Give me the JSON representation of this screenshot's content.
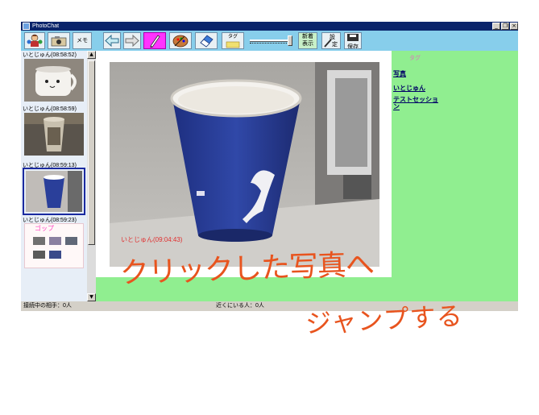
{
  "window": {
    "title": "PhotoChat"
  },
  "toolbar": {
    "memo_label": "メモ",
    "tag_label": "タグ",
    "new_label_line1": "新着",
    "new_label_line2": "表示",
    "settings_label_line1": "設",
    "settings_label_line2": "定",
    "save_label": "保存"
  },
  "thumbnails": [
    {
      "caption": "いとじゅん(08:58:52)"
    },
    {
      "caption": "いとじゅん(08:58:59)"
    },
    {
      "caption": "いとじゅん(08:59:13)"
    },
    {
      "caption": "いとじゅん(08:59:23)"
    }
  ],
  "thumb4": {
    "handwriting": "ゴップ"
  },
  "main": {
    "photo_overlay": "いとじゅん(09:04:43)"
  },
  "annotation": {
    "line1": "クリックした写真へ",
    "line2": "ジャンプする"
  },
  "tags": {
    "heading": "タグ",
    "items": [
      "写真",
      "いとじゅん",
      "テストセッショ",
      "ン"
    ]
  },
  "status": {
    "connected": "接続中の相手：0人",
    "nearby": "近くにいる人：0人"
  },
  "colors": {
    "toolbar_bg": "#87ceeb",
    "panel_green": "#90ee90",
    "titlebar": "#0a246a",
    "annotation": "#e8541e",
    "cup_blue": "#2a3f9a"
  }
}
